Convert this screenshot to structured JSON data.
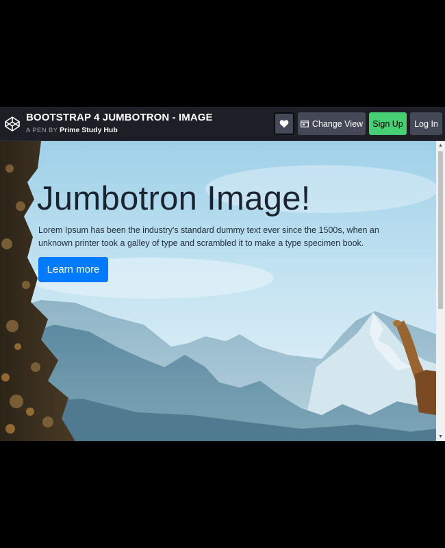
{
  "header": {
    "title": "BOOTSTRAP 4 JUMBOTRON - IMAGE",
    "byline_prefix": "A PEN BY",
    "author": "Prime Study Hub",
    "buttons": {
      "change_view": "Change View",
      "sign_up": "Sign Up",
      "log_in": "Log In"
    }
  },
  "icons": {
    "logo": "codepen-logo-icon",
    "heart": "heart-icon",
    "change_view": "layout-icon"
  },
  "jumbotron": {
    "heading": "Jumbotron Image!",
    "lead": "Lorem Ipsum has been the industry's standard dummy text ever since the 1500s, when an unknown printer took a galley of type and scrambled it to make a type specimen book.",
    "button": "Learn more"
  },
  "colors": {
    "header_bg": "#1e1f26",
    "button_bg": "#444857",
    "signup_bg": "#47cf73",
    "primary": "#007bff"
  }
}
